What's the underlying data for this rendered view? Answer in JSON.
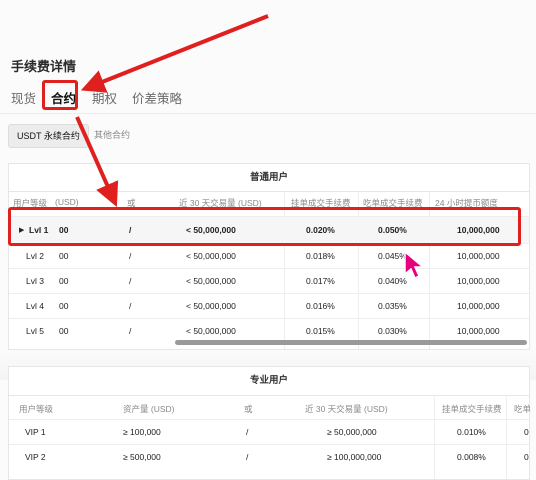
{
  "page": {
    "title": "手续费详情"
  },
  "tabs": [
    {
      "label": "现货",
      "active": false
    },
    {
      "label": "合约",
      "active": true
    },
    {
      "label": "期权",
      "active": false
    },
    {
      "label": "价差策略",
      "active": false
    }
  ],
  "subtabs": [
    {
      "label": "USDT 永续合约",
      "active": true
    },
    {
      "label": "其他合约",
      "active": false
    }
  ],
  "regular": {
    "title": "普通用户",
    "headers": [
      "用户等级",
      "(USD)",
      "或",
      "近 30 天交易量 (USD)",
      "挂单成交手续费",
      "吃单成交手续费",
      "24 小时提币额度"
    ],
    "rows": [
      {
        "marker": "▶",
        "level": "Lvl 1",
        "asset": "00",
        "or": "/",
        "volume": "< 50,000,000",
        "maker": "0.020%",
        "taker": "0.050%",
        "limit": "10,000,000"
      },
      {
        "marker": "",
        "level": "Lvl 2",
        "asset": "00",
        "or": "/",
        "volume": "< 50,000,000",
        "maker": "0.018%",
        "taker": "0.045%",
        "limit": "10,000,000"
      },
      {
        "marker": "",
        "level": "Lvl 3",
        "asset": "00",
        "or": "/",
        "volume": "< 50,000,000",
        "maker": "0.017%",
        "taker": "0.040%",
        "limit": "10,000,000"
      },
      {
        "marker": "",
        "level": "Lvl 4",
        "asset": "00",
        "or": "/",
        "volume": "< 50,000,000",
        "maker": "0.016%",
        "taker": "0.035%",
        "limit": "10,000,000"
      },
      {
        "marker": "",
        "level": "Lvl 5",
        "asset": "00",
        "or": "/",
        "volume": "< 50,000,000",
        "maker": "0.015%",
        "taker": "0.030%",
        "limit": "10,000,000"
      }
    ]
  },
  "pro": {
    "title": "专业用户",
    "headers": [
      "用户等级",
      "资产量 (USD)",
      "或",
      "近 30 天交易量 (USD)",
      "挂单成交手续费",
      "吃单"
    ],
    "rows": [
      {
        "level": "VIP 1",
        "asset": "≥ 100,000",
        "or": "/",
        "volume": "≥ 50,000,000",
        "maker": "0.010%",
        "taker": "0"
      },
      {
        "level": "VIP 2",
        "asset": "≥ 500,000",
        "or": "/",
        "volume": "≥ 100,000,000",
        "maker": "0.008%",
        "taker": "0"
      }
    ]
  },
  "colors": {
    "annotation": "#e0201f",
    "cursor": "#e6007e"
  },
  "icons": {
    "row_marker": "triangle-right-icon",
    "cursor": "pointer-cursor-icon"
  }
}
